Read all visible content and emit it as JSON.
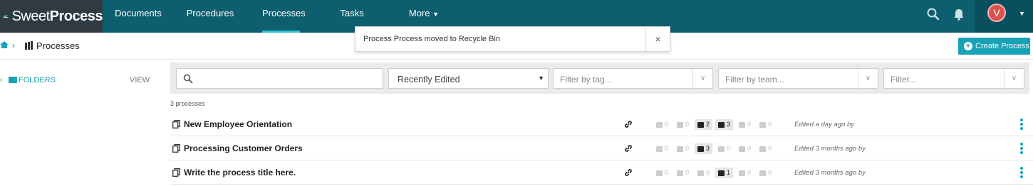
{
  "brand": {
    "name_light": "Sweet",
    "name_bold": "Process"
  },
  "nav": {
    "items": [
      {
        "label": "Documents"
      },
      {
        "label": "Procedures"
      },
      {
        "label": "Processes",
        "active": true
      },
      {
        "label": "Tasks"
      },
      {
        "label": "More"
      }
    ],
    "avatar_letter": "V"
  },
  "breadcrumb": {
    "current": "Processes"
  },
  "toast": {
    "message": "Process Process moved to Recycle Bin",
    "close": "×"
  },
  "create_button": {
    "label": "Create Process"
  },
  "sidebar": {
    "folders_label": "FOLDERS",
    "view_label": "VIEW"
  },
  "filters": {
    "search_placeholder": "",
    "sort_value": "Recently Edited",
    "tag_placeholder": "Filter by tag...",
    "team_placeholder": "Filter by team...",
    "other_placeholder": "Filter..."
  },
  "list": {
    "count_label": "3 processes",
    "rows": [
      {
        "title": "New Employee Orientation",
        "stats": [
          "0",
          "0",
          "2",
          "3",
          "0",
          "0"
        ],
        "edited": "Edited a day ago by"
      },
      {
        "title": "Processing Customer Orders",
        "stats": [
          "0",
          "0",
          "3",
          "0",
          "0",
          "0"
        ],
        "edited": "Edited 3 months ago by"
      },
      {
        "title": "Write the process title here.",
        "stats": [
          "0",
          "0",
          "0",
          "1",
          "0",
          "0"
        ],
        "edited": "Edited 3 months ago by"
      }
    ]
  },
  "colors": {
    "nav_bg": "#0d5e6e",
    "accent": "#17a2b8",
    "logo_bg": "#2f3a42"
  }
}
